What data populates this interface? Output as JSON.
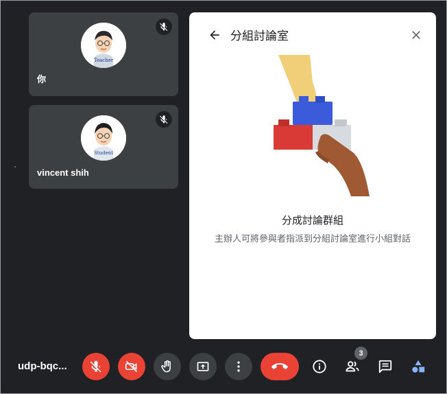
{
  "participants": [
    {
      "name": "你",
      "avatar_caption": "Teacher",
      "muted": true
    },
    {
      "name": "vincent shih",
      "avatar_caption": "Student",
      "muted": true
    }
  ],
  "breakout_panel": {
    "title": "分組討論室",
    "heading": "分成討論群組",
    "description": "主辦人可將參與者指派到分組討論室進行小組對話",
    "back_icon": "arrow-back-icon",
    "close_icon": "close-icon"
  },
  "toolbar": {
    "meeting_code": "udp-bqc...",
    "people_count": "3",
    "buttons": [
      "mic-off-icon",
      "camera-off-icon",
      "raise-hand-icon",
      "present-screen-icon",
      "more-options-icon",
      "hang-up-icon",
      "meeting-info-icon",
      "people-icon",
      "chat-icon",
      "activities-icon"
    ]
  },
  "colors": {
    "background": "#202124",
    "tile": "#3c4043",
    "danger": "#ea4335",
    "accent": "#8ab4f8"
  }
}
